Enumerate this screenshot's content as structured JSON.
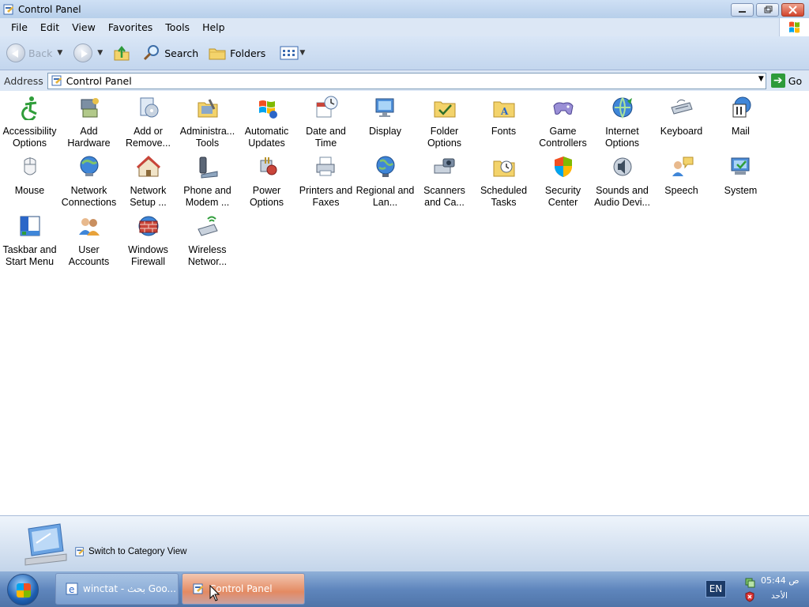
{
  "window": {
    "title": "Control Panel",
    "buttons": [
      "minimize",
      "restore",
      "close"
    ]
  },
  "menu": [
    "File",
    "Edit",
    "View",
    "Favorites",
    "Tools",
    "Help"
  ],
  "toolbar": {
    "back_label": "Back",
    "search_label": "Search",
    "folders_label": "Folders",
    "icons": [
      "back-arrow-icon",
      "forward-arrow-icon",
      "up-folder-icon",
      "search-icon",
      "folders-icon",
      "views-icon"
    ]
  },
  "address": {
    "label": "Address",
    "value": "Control Panel",
    "go_label": "Go"
  },
  "items": [
    {
      "label": "Accessibility Options",
      "icon": "accessibility-icon"
    },
    {
      "label": "Add Hardware",
      "icon": "add-hardware-icon"
    },
    {
      "label": "Add or Remove...",
      "icon": "add-remove-programs-icon"
    },
    {
      "label": "Administra... Tools",
      "icon": "administrative-tools-icon"
    },
    {
      "label": "Automatic Updates",
      "icon": "automatic-updates-icon"
    },
    {
      "label": "Date and Time",
      "icon": "date-time-icon"
    },
    {
      "label": "Display",
      "icon": "display-icon"
    },
    {
      "label": "Folder Options",
      "icon": "folder-options-icon"
    },
    {
      "label": "Fonts",
      "icon": "fonts-icon"
    },
    {
      "label": "Game Controllers",
      "icon": "game-controllers-icon"
    },
    {
      "label": "Internet Options",
      "icon": "internet-options-icon"
    },
    {
      "label": "Keyboard",
      "icon": "keyboard-icon"
    },
    {
      "label": "Mail",
      "icon": "mail-icon"
    },
    {
      "label": "Mouse",
      "icon": "mouse-icon"
    },
    {
      "label": "Network Connections",
      "icon": "network-connections-icon"
    },
    {
      "label": "Network Setup ...",
      "icon": "network-setup-icon"
    },
    {
      "label": "Phone and Modem ...",
      "icon": "phone-modem-icon"
    },
    {
      "label": "Power Options",
      "icon": "power-options-icon"
    },
    {
      "label": "Printers and Faxes",
      "icon": "printers-faxes-icon"
    },
    {
      "label": "Regional and Lan...",
      "icon": "regional-language-icon"
    },
    {
      "label": "Scanners and Ca...",
      "icon": "scanners-cameras-icon"
    },
    {
      "label": "Scheduled Tasks",
      "icon": "scheduled-tasks-icon"
    },
    {
      "label": "Security Center",
      "icon": "security-center-icon"
    },
    {
      "label": "Sounds and Audio Devi...",
      "icon": "sounds-audio-icon"
    },
    {
      "label": "Speech",
      "icon": "speech-icon"
    },
    {
      "label": "System",
      "icon": "system-icon"
    },
    {
      "label": "Taskbar and Start Menu",
      "icon": "taskbar-start-menu-icon"
    },
    {
      "label": "User Accounts",
      "icon": "user-accounts-icon"
    },
    {
      "label": "Windows Firewall",
      "icon": "windows-firewall-icon"
    },
    {
      "label": "Wireless Networ...",
      "icon": "wireless-network-icon"
    }
  ],
  "info_panel": {
    "switch_label": "Switch to Category View"
  },
  "taskbar": {
    "tasks": [
      {
        "label": "winctat - بحث Goo...",
        "icon": "internet-explorer-icon"
      },
      {
        "label": "Control Panel",
        "icon": "control-panel-icon"
      }
    ],
    "language": "EN",
    "clock_time": "05:44 ص",
    "clock_day": "الأحد"
  },
  "colors": {
    "title_bar": "#c4d8f0",
    "taskbar": "#5f86bd",
    "content_bg": "#ffffff"
  }
}
